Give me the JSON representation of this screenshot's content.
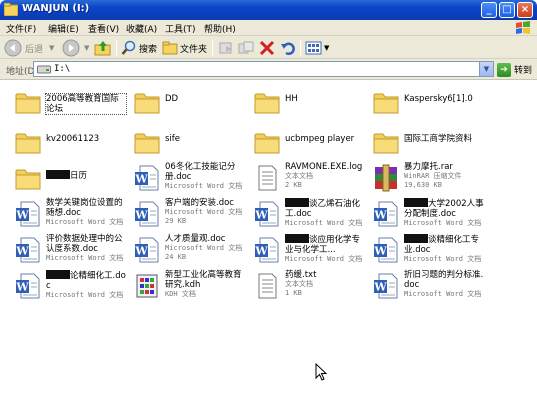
{
  "window": {
    "title": "WANJUN (I:)"
  },
  "menu": [
    "文件(F)",
    "编辑(E)",
    "查看(V)",
    "收藏(A)",
    "工具(T)",
    "帮助(H)"
  ],
  "toolbar": {
    "back": "后退",
    "search": "搜索",
    "folders": "文件夹"
  },
  "address": {
    "label": "地址(D)",
    "value": "I:\\",
    "go": "转到"
  },
  "items": [
    {
      "type": "folder",
      "name": "2006高等教育国际论坛",
      "meta": []
    },
    {
      "type": "folder",
      "name": "DD",
      "meta": []
    },
    {
      "type": "folder",
      "name": "HH",
      "meta": []
    },
    {
      "type": "folder",
      "name": "Kaspersky6[1].0",
      "meta": []
    },
    {
      "type": "folder",
      "name": "kv20061123",
      "meta": []
    },
    {
      "type": "folder",
      "name": "sife",
      "meta": []
    },
    {
      "type": "folder",
      "name": "ucbmpeg player",
      "meta": []
    },
    {
      "type": "folder",
      "name": "国际工商学院资料",
      "meta": []
    },
    {
      "type": "folder",
      "name": "日历",
      "redact": true,
      "meta": []
    },
    {
      "type": "word",
      "name": "06冬化工技能记分册.doc",
      "meta": [
        "Microsoft Word 文档"
      ]
    },
    {
      "type": "text",
      "name": "RAVMONE.EXE.log",
      "meta": [
        "文本文档",
        "2 KB"
      ]
    },
    {
      "type": "rar",
      "name": "暴力摩托.rar",
      "meta": [
        "WinRAR 压缩文件",
        "19,630 KB"
      ]
    },
    {
      "type": "word",
      "name": "数学关键岗位设置的随想.doc",
      "meta": [
        "Microsoft Word 文档"
      ]
    },
    {
      "type": "word",
      "name": "客户端的安装.doc",
      "meta": [
        "Microsoft Word 文档",
        "29 KB"
      ]
    },
    {
      "type": "word",
      "name": "谈乙烯石油化工.doc",
      "redact": true,
      "meta": [
        "Microsoft Word 文档"
      ]
    },
    {
      "type": "word",
      "name": "大学2002人事分配制度.doc",
      "redact": true,
      "meta": [
        "Microsoft Word 文档"
      ]
    },
    {
      "type": "word",
      "name": "评价数据处理中的公认度系数.doc",
      "meta": [
        "Microsoft Word 文档"
      ]
    },
    {
      "type": "word",
      "name": "人才质量观.doc",
      "meta": [
        "Microsoft Word 文档",
        "24 KB"
      ]
    },
    {
      "type": "word",
      "name": "谈应用化学专业与化学工...",
      "redact": true,
      "meta": [
        "Microsoft Word 文档"
      ]
    },
    {
      "type": "word",
      "name": "谈精细化工专业.doc",
      "redact": true,
      "meta": [
        "Microsoft Word 文档"
      ]
    },
    {
      "type": "word",
      "name": "论精细化工.doc",
      "redact": true,
      "meta": [
        "Microsoft Word 文档"
      ]
    },
    {
      "type": "kdh",
      "name": "新型工业化高等教育研究.kdh",
      "meta": [
        "KDH 文档"
      ]
    },
    {
      "type": "text",
      "name": "药缓.txt",
      "meta": [
        "文本文档",
        "1 KB"
      ]
    },
    {
      "type": "word",
      "name": "折旧习题的判分标准.doc",
      "meta": [
        "Microsoft Word 文档"
      ]
    }
  ]
}
